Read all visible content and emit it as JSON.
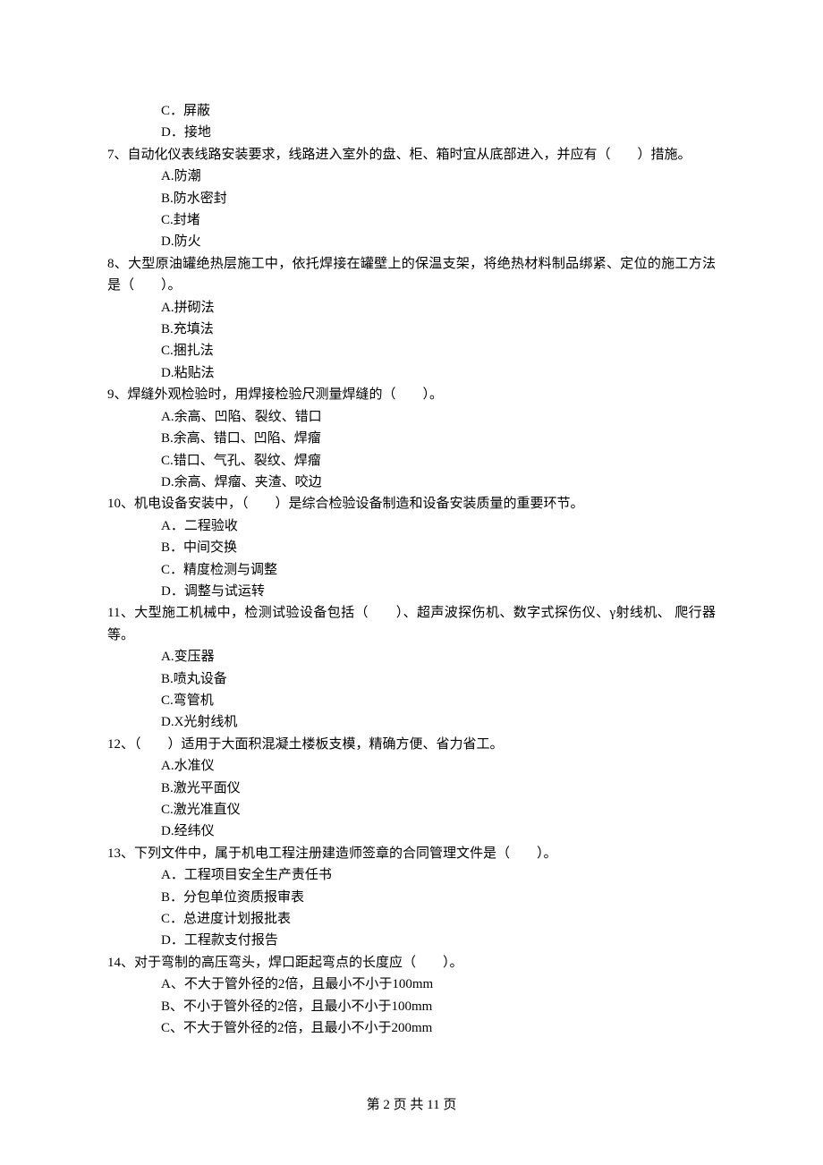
{
  "q6": {
    "optC": "C．屏蔽",
    "optD": "D．接地"
  },
  "q7": {
    "stem": "7、自动化仪表线路安装要求，线路进入室外的盘、柜、箱时宜从底部进入，并应有（　　）措施。",
    "optA": "A.防潮",
    "optB": "B.防水密封",
    "optC": "C.封堵",
    "optD": "D.防火"
  },
  "q8": {
    "stem": "8、大型原油罐绝热层施工中，依托焊接在罐壁上的保温支架，将绝热材料制品绑紧、定位的施工方法是（　　）。",
    "optA": "A.拼砌法",
    "optB": "B.充填法",
    "optC": "C.捆扎法",
    "optD": "D.粘贴法"
  },
  "q9": {
    "stem": "9、焊缝外观检验时，用焊接检验尺测量焊缝的（　　）。",
    "optA": "A.余高、凹陷、裂纹、错口",
    "optB": "B.余高、错口、凹陷、焊瘤",
    "optC": "C.错口、气孔、裂纹、焊瘤",
    "optD": "D.余高、焊瘤、夹渣、咬边"
  },
  "q10": {
    "stem": "10、机电设备安装中，（　　）是综合检验设备制造和设备安装质量的重要环节。",
    "optA": "A．二程验收",
    "optB": "B．中间交换",
    "optC": "C．精度检测与调整",
    "optD": "D．调整与试运转"
  },
  "q11": {
    "stem": "11、大型施工机械中，检测试验设备包括（　　）、超声波探伤机、数字式探伤仪、γ射线机、 爬行器等。",
    "optA": "A.变压器",
    "optB": "B.喷丸设备",
    "optC": "C.弯管机",
    "optD": "D.X光射线机"
  },
  "q12": {
    "stem": "12、（　　）适用于大面积混凝土楼板支模，精确方便、省力省工。",
    "optA": "A.水准仪",
    "optB": "B.激光平面仪",
    "optC": "C.激光准直仪",
    "optD": "D.经纬仪"
  },
  "q13": {
    "stem": "13、下列文件中，属于机电工程注册建造师签章的合同管理文件是（　　）。",
    "optA": "A．工程项目安全生产责任书",
    "optB": "B．分包单位资质报审表",
    "optC": "C．总进度计划报批表",
    "optD": "D．工程款支付报告"
  },
  "q14": {
    "stem": "14、对于弯制的高压弯头，焊口距起弯点的长度应（　　）。",
    "optA": "A、不大于管外径的2倍，且最小不小于100mm",
    "optB": "B、不小于管外径的2倍，且最小不小于100mm",
    "optC": "C、不大于管外径的2倍，且最小不小于200mm"
  },
  "footer": "第 2 页 共 11 页"
}
